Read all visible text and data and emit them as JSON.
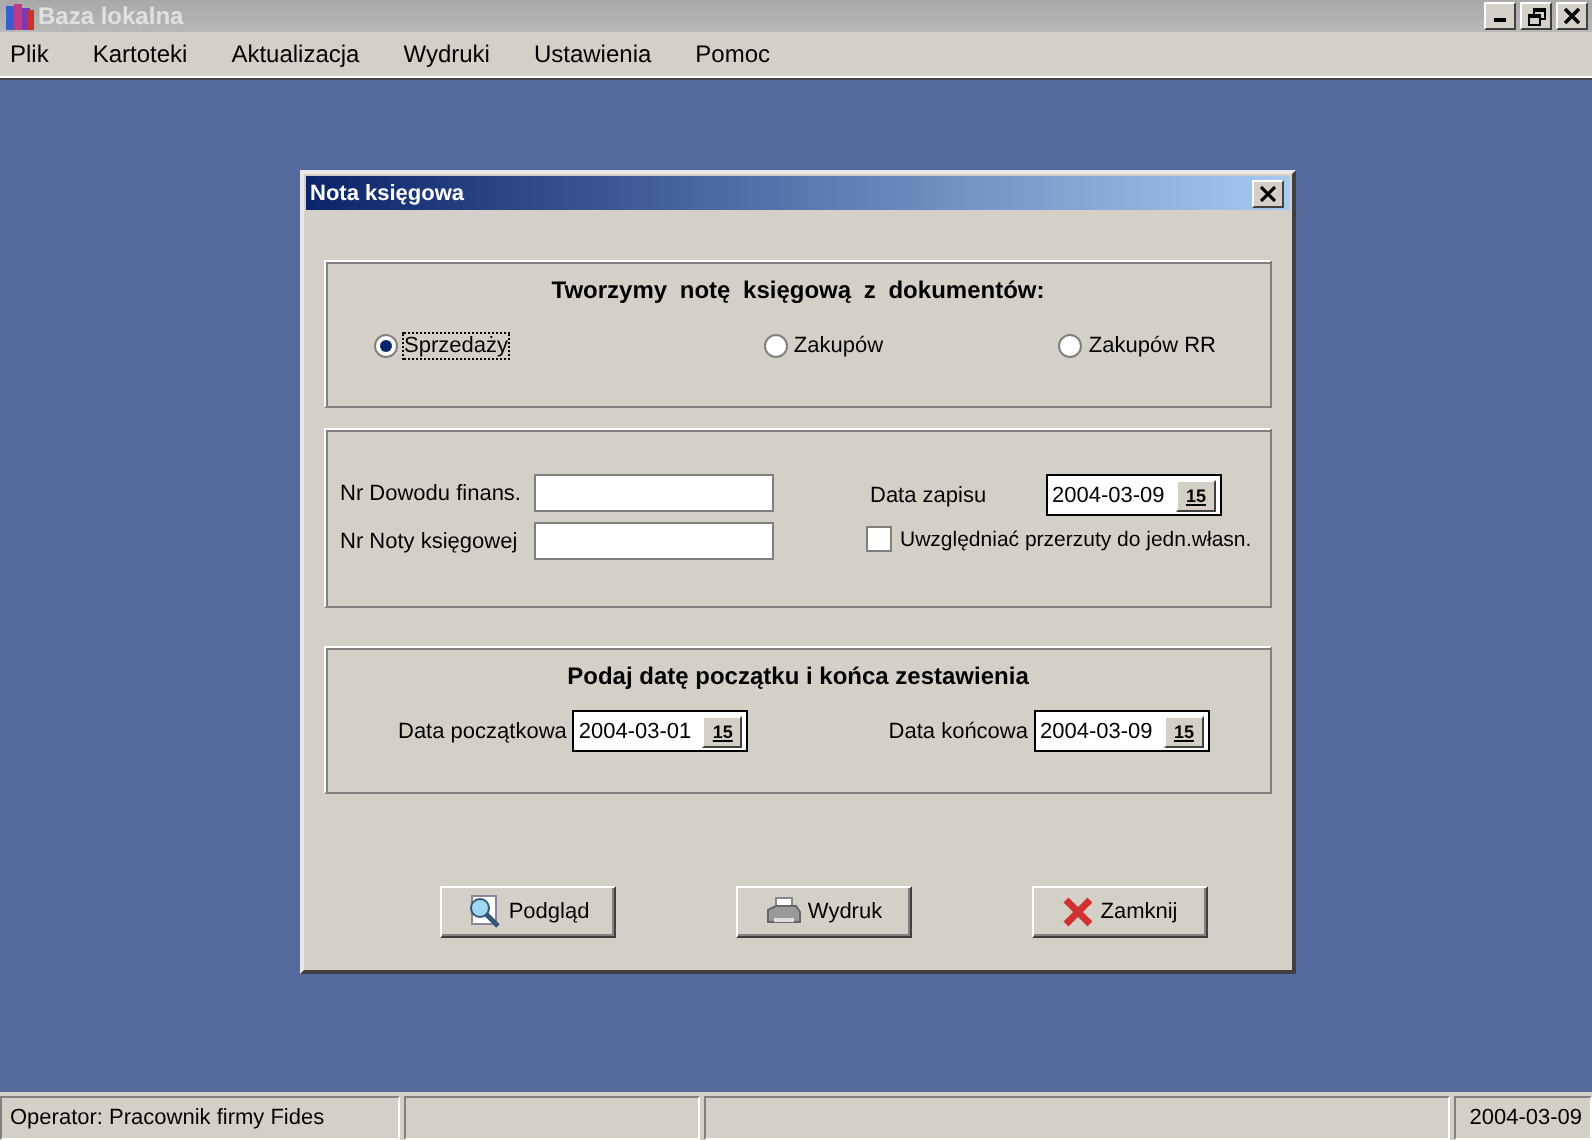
{
  "window": {
    "title": "Baza lokalna"
  },
  "menu": [
    "Plik",
    "Kartoteki",
    "Aktualizacja",
    "Wydruki",
    "Ustawienia",
    "Pomoc"
  ],
  "dialog": {
    "title": "Nota księgowa",
    "source": {
      "heading": "Tworzymy notę księgową z dokumentów:",
      "options": [
        {
          "label": "Sprzedaży",
          "selected": true
        },
        {
          "label": "Zakupów",
          "selected": false
        },
        {
          "label": "Zakupów RR",
          "selected": false
        }
      ]
    },
    "numbers": {
      "fields": [
        {
          "label": "Nr Dowodu finans."
        },
        {
          "label": "Nr Noty księgowej"
        }
      ],
      "entry_date": {
        "label": "Data zapisu",
        "value": "2004-03-09",
        "button": "15"
      },
      "option": {
        "label": "Uwzględniać przerzuty do jedn.własn.",
        "checked": false
      }
    },
    "period": {
      "heading": "Podaj datę początku i końca zestawienia",
      "dates": [
        {
          "label": "Data początkowa",
          "value": "2004-03-01",
          "button": "15"
        },
        {
          "label": "Data końcowa",
          "value": "2004-03-09",
          "button": "15"
        }
      ]
    },
    "buttons": [
      {
        "label": "Podgląd",
        "kind": "preview"
      },
      {
        "label": "Wydruk",
        "kind": "print"
      },
      {
        "label": "Zamknij",
        "kind": "close"
      }
    ]
  },
  "status_bar": {
    "operator": "Operator: Pracownik firmy Fides",
    "date": "2004-03-09"
  }
}
